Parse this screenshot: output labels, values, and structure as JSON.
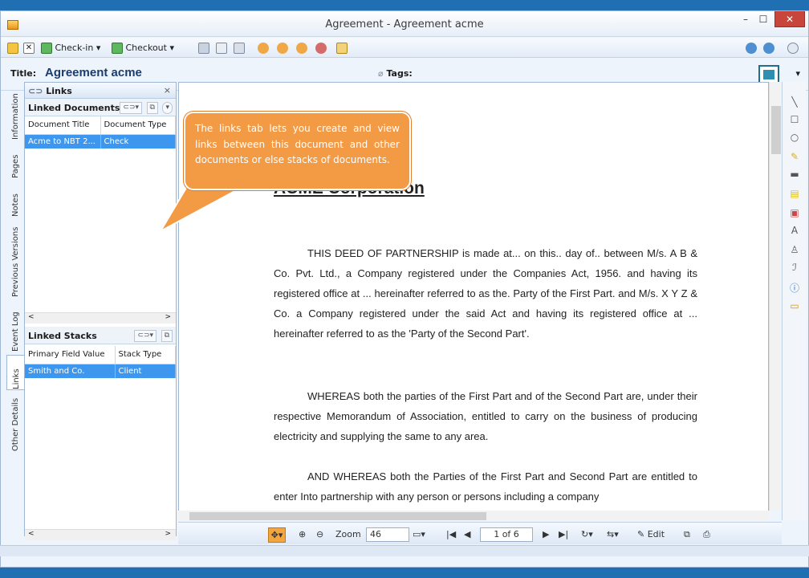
{
  "window": {
    "title": "Agreement - Agreement acme",
    "minimize": "–",
    "maximize": "☐",
    "close": "✕"
  },
  "toolbar": {
    "checkin_label": "Check-in",
    "checkout_label": "Checkout",
    "dropdown": "▾"
  },
  "header": {
    "title_label": "Title:",
    "title_value": "Agreement acme",
    "tags_label": "Tags:"
  },
  "side_tabs": [
    "Information",
    "Pages",
    "Notes",
    "Previous Versions",
    "Event Log",
    "Links",
    "Other Details"
  ],
  "links_panel": {
    "title": "Links",
    "close": "×",
    "linked_documents": {
      "title": "Linked Documents",
      "columns": [
        "Document Title",
        "Document Type"
      ],
      "rows": [
        [
          "Acme to NBT 2...",
          "Check"
        ]
      ]
    },
    "linked_stacks": {
      "title": "Linked Stacks",
      "columns": [
        "Primary Field Value",
        "Stack Type"
      ],
      "rows": [
        [
          "Smith and Co.",
          "Client"
        ]
      ]
    },
    "scroll_left": "<",
    "scroll_right": ">"
  },
  "callout": {
    "text": "The links tab lets you create and view links between this document and other documents or else stacks of documents."
  },
  "document": {
    "heading": "ACME Corporation",
    "paragraphs": [
      "THIS DEED OF PARTNERSHIP is made at... on this.. day of.. between M/s. A B & Co. Pvt. Ltd., a Company registered under the Companies Act, 1956. and having its registered office at ... hereinafter referred to as the. Party of the First Part. and M/s. X Y Z & Co. a Company registered under the said Act and having its registered office at ... hereinafter referred to as the 'Party of the Second Part'.",
      "WHEREAS both the parties of the First Part and of the Second Part are, under their respective Memorandum of Association, entitled to carry on the business of producing electricity and supplying the same to any area.",
      "AND WHEREAS both the Parties of the First Part and Second Part are entitled to enter Into partnership with any person or persons including a company"
    ]
  },
  "viewer": {
    "zoom_label": "Zoom",
    "zoom_value": "46",
    "page_display": "1 of 6",
    "edit_label": "Edit"
  }
}
